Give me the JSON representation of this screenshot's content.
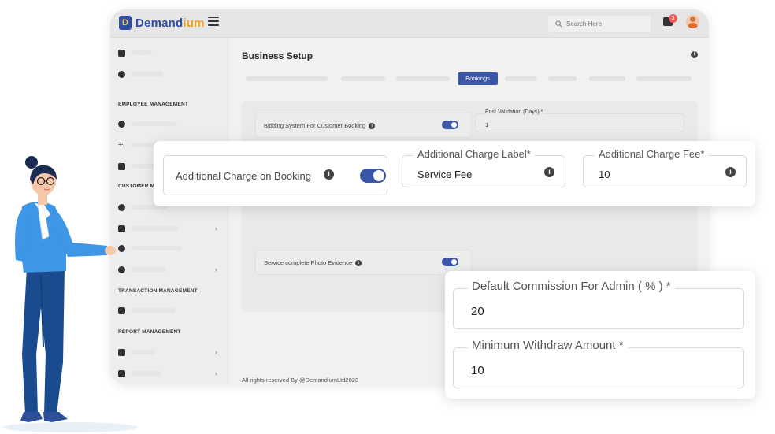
{
  "app": {
    "brand_prefix": "Demand",
    "brand_highlight": "ium",
    "logo_letter": "D"
  },
  "topbar": {
    "search_placeholder": "Search Here",
    "notification_count": "3"
  },
  "sidebar": {
    "sections": [
      "EMPLOYEE MANAGEMENT",
      "CUSTOMER M",
      "TRANSACTION MANAGEMENT",
      "REPORT MANAGEMENT"
    ]
  },
  "main": {
    "page_title": "Business Setup",
    "active_tab": "Bookings",
    "bidding_label": "Bidding System For Customer Booking",
    "post_validation_label": "Post Validation (Days) *",
    "post_validation_value": "1",
    "photo_evidence_label": "Service complete Photo Evidence",
    "footer_text": "All rights reserved By @DemandiumLtd2023"
  },
  "charge_card": {
    "toggle_label": "Additional Charge on Booking",
    "toggle_on": true,
    "label_field_label": "Additional Charge Label*",
    "label_field_value": "Service Fee",
    "fee_field_label": "Additional Charge Fee*",
    "fee_field_value": "10"
  },
  "commission_card": {
    "commission_label": "Default Commission For Admin ( % ) *",
    "commission_value": "20",
    "withdraw_label": "Minimum Withdraw Amount *",
    "withdraw_value": "10"
  },
  "colors": {
    "primary": "#3b55a7",
    "brand_accent": "#f0a020",
    "badge": "#ef5b5b"
  },
  "icons": [
    "menu-icon",
    "search-icon",
    "chat-icon",
    "info-icon",
    "avatar"
  ]
}
